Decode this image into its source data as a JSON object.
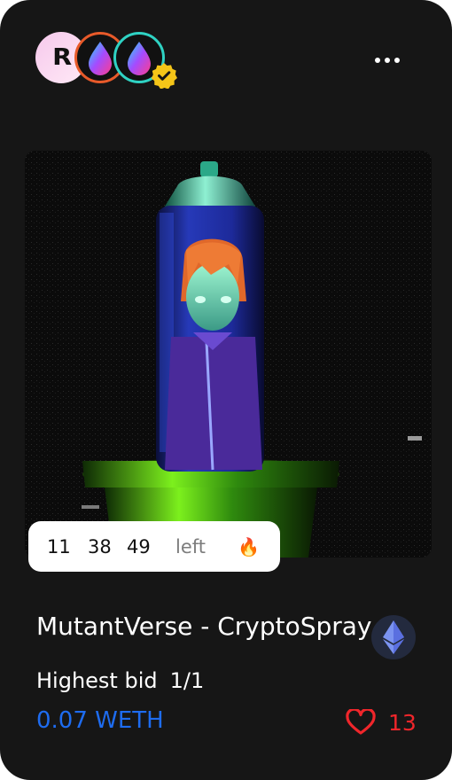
{
  "header": {
    "avatars": [
      {
        "type": "logo",
        "text": "R"
      },
      {
        "type": "drop-icon"
      },
      {
        "type": "drop-icon"
      }
    ],
    "verified_icon": "verified-badge-icon",
    "more_icon": "more-dots-icon"
  },
  "timer": {
    "hours": "11",
    "minutes": "38",
    "seconds": "49",
    "suffix": "left",
    "emoji": "🔥"
  },
  "item": {
    "title": "MutantVerse - CryptoSpray",
    "chain_icon": "ethereum-icon"
  },
  "bid": {
    "label": "Highest bid",
    "edition": "1/1",
    "price": "0.07 WETH"
  },
  "likes": {
    "count": "13",
    "icon": "heart-icon"
  },
  "colors": {
    "card_bg": "#161616",
    "price": "#1e6cf0",
    "likes": "#f0262b",
    "verified": "#f5c518"
  }
}
